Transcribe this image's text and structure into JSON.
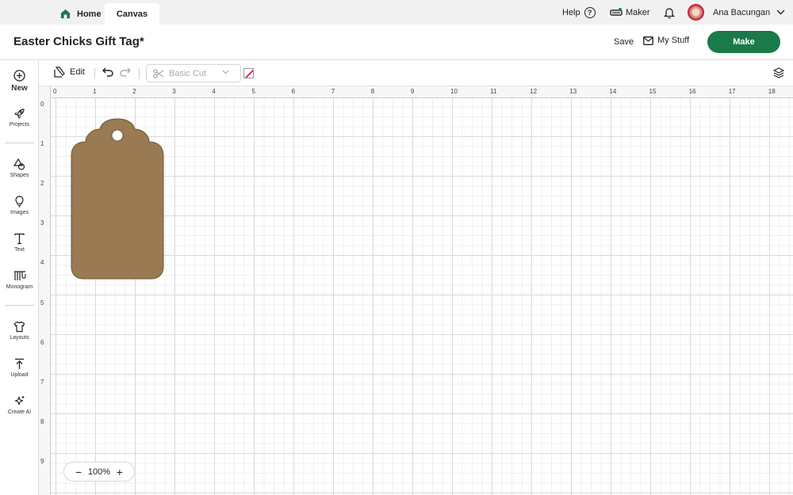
{
  "tabs": {
    "home": "Home",
    "canvas": "Canvas"
  },
  "topright": {
    "help": "Help",
    "machine": "Maker",
    "user_name": "Ana Bacungan"
  },
  "project": {
    "title": "Easter Chicks Gift Tag*",
    "save": "Save",
    "my_stuff": "My Stuff",
    "make": "Make"
  },
  "toolbar": {
    "edit": "Edit",
    "operation": "Basic Cut"
  },
  "rail": {
    "new": "New",
    "projects": "Projects",
    "shapes": "Shapes",
    "images": "Images",
    "text": "Text",
    "monogram": "Monogram",
    "layouts": "Layouts",
    "upload": "Upload",
    "create_ai": "Create AI"
  },
  "ruler": {
    "top": [
      "0",
      "1",
      "2",
      "3",
      "4",
      "5",
      "6",
      "7",
      "8",
      "9",
      "10",
      "11",
      "12",
      "13",
      "14",
      "15",
      "16",
      "17",
      "18"
    ],
    "left": [
      "0",
      "1",
      "2",
      "3",
      "4",
      "5",
      "6",
      "7",
      "8",
      "9"
    ]
  },
  "canvas": {
    "shape": "gift-tag",
    "shape_color": "#9a7a52"
  },
  "colors": {
    "accent": "#1a7a4a",
    "tab_bg": "#f1f1f1"
  },
  "zoom": {
    "minus": "−",
    "level": "100%",
    "plus": "+"
  }
}
